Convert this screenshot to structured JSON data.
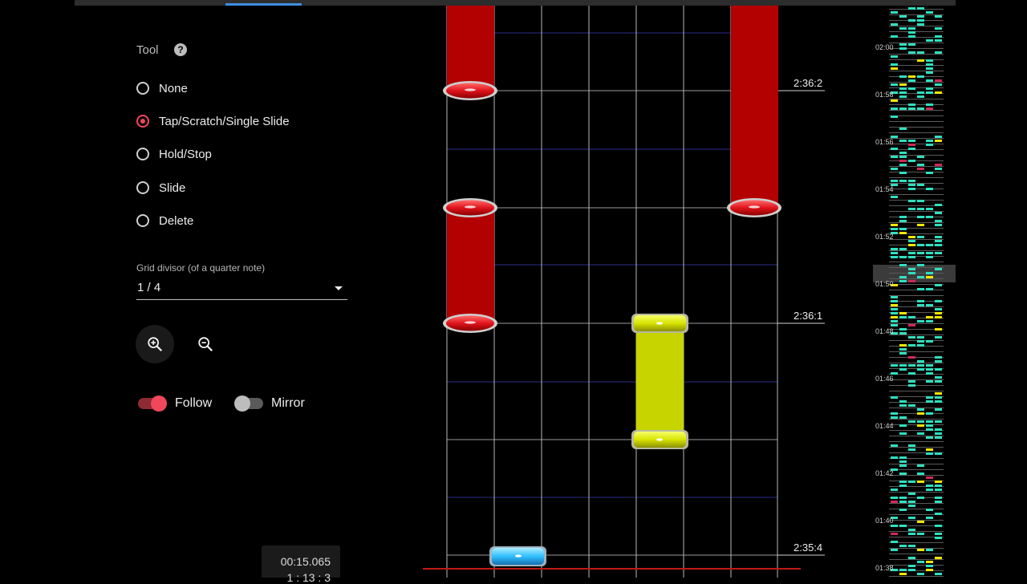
{
  "tool": {
    "title": "Tool",
    "help_icon": "help-circle-icon",
    "options": [
      {
        "label": "None",
        "checked": false
      },
      {
        "label": "Tap/Scratch/Single Slide",
        "checked": true
      },
      {
        "label": "Hold/Stop",
        "checked": false
      },
      {
        "label": "Slide",
        "checked": false
      },
      {
        "label": "Delete",
        "checked": false
      }
    ]
  },
  "grid": {
    "label": "Grid divisor (of a quarter note)",
    "value": "1 / 4"
  },
  "zoom": {
    "in_icon": "zoom-in-icon",
    "out_icon": "zoom-out-icon"
  },
  "toggles": {
    "follow": {
      "label": "Follow",
      "on": true
    },
    "mirror": {
      "label": "Mirror",
      "on": false
    }
  },
  "time": {
    "current": "00:15.065",
    "measure": "1 : 13 : 3"
  },
  "colors": {
    "accent": "#f0485a",
    "hold_note": "#b30000",
    "slide_note": "#c8d400",
    "tap_note": "#3ec8ff",
    "minimap_note": "#2fe0c0",
    "minimap_yellow": "#f2e600"
  },
  "beat_labels": [
    "2:36:2",
    "2:36:1",
    "2:35:4"
  ],
  "minimap": {
    "labels": [
      "02:00",
      "01:58",
      "01:56",
      "01:54",
      "01:52",
      "01:50",
      "01:48",
      "01:46",
      "01:44",
      "01:42",
      "01:40",
      "01:38"
    ]
  }
}
